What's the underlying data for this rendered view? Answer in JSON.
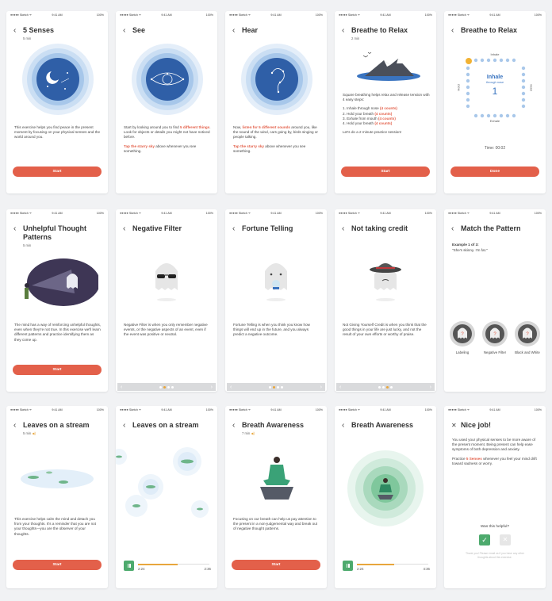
{
  "status": {
    "carrier": "●●●●● Sketch ᯤ",
    "time": "9:41 AM",
    "battery": "100%"
  },
  "colors": {
    "accent": "#e3604a",
    "green": "#4daa6d",
    "orange": "#e8a63c",
    "blue": "#3a74c0"
  },
  "s1": {
    "title": "5 Senses",
    "sub": "5 min",
    "body": "This exercise helps you find peace in the present moment by focusing on your physical senses and the world around you.",
    "btn": "Start"
  },
  "s2": {
    "title": "See",
    "b1": "Start by looking around you to find ",
    "b1h": "5 different things",
    "b1e": ". Look for objects or details you might not have noticed before.",
    "b2h": "Tap the starry sky",
    "b2e": " above whenever you see something."
  },
  "s3": {
    "title": "Hear",
    "b1": "Now, ",
    "b1h": "listen for 5 different sounds",
    "b1e": " around you, like the sound of the wind, cars going by, birds singing or people talking.",
    "b2h": "Tap the starry sky",
    "b2e": " above whenever you see something."
  },
  "s4": {
    "title": "Breathe to Relax",
    "sub": "2 min",
    "intro": "Square breathing helps relax and release tension with 4 easy steps:",
    "steps": [
      {
        "t": "1. Inhale through nose ",
        "h": "(4 counts)"
      },
      {
        "t": "2. Hold your breath ",
        "h": "(4 counts)"
      },
      {
        "t": "3. Exhale from mouth ",
        "h": "(4 counts)"
      },
      {
        "t": "4. Hold your breath ",
        "h": "(4 counts)"
      }
    ],
    "outro": "Let's do a 2 minute practice session!",
    "btn": "Start"
  },
  "s5": {
    "title": "Breathe to Relax",
    "top": "Inhale",
    "left": "Hold",
    "right": "Hold",
    "bottom": "Exhale",
    "phase": "Inhale",
    "through": "through nose",
    "count": "1",
    "timer": "Time: 00:02",
    "btn": "Done"
  },
  "s6": {
    "title": "Unhelpful Thought Patterns",
    "sub": "5 min",
    "body": "The mind has a way of reinforcing unhelpful thoughts, even when they're not true. In this exercise we'll learn different patterns and practice identifying them as they come up.",
    "btn": "Start"
  },
  "s7": {
    "title": "Negative Filter",
    "body": "Negative Filter is when you only remember negative events, or the negative aspects of an event, even if the event was positive or neutral."
  },
  "s8": {
    "title": "Fortune Telling",
    "body": "Fortune Telling is when you think you know how things will end up in the future, and you always predict a negative outcome."
  },
  "s9": {
    "title": "Not taking credit",
    "body": "Not Giving Yourself Credit is when you think that the good things in your life are just lucky, and not the result of your own efforts or worthy of praise."
  },
  "s10": {
    "title": "Match the Pattern",
    "example": "Example 1 of 3:",
    "quote": "\"She's skinny. I'm fat.\"",
    "options": [
      "Labeling",
      "Negative Filter",
      "Black and White"
    ]
  },
  "s11": {
    "title": "Leaves on a stream",
    "sub": "5 min",
    "body": "This exercise helps calm the mind and detach you from your thoughts. It's a reminder that you are not your thoughts—you are the observer of your thoughts.",
    "btn": "Start"
  },
  "s12": {
    "title": "Leaves on a stream",
    "t1": "2:24",
    "t2": "2:36",
    "progress": 0.55
  },
  "s13": {
    "title": "Breath Awareness",
    "sub": "7 min",
    "body": "Focusing on our breath can help us pay attention to the present in a non-judgemental way and break out of negative thought patterns.",
    "btn": "Start"
  },
  "s14": {
    "title": "Breath Awareness",
    "t1": "2:24",
    "t2": "4:36",
    "progress": 0.52
  },
  "s15": {
    "title": "Nice job!",
    "b1": "You used your physical senses to be more aware of the present moment. Being present can help ease symptoms of both depression and anxiety.",
    "b2": "Practice ",
    "b2h": "5 Senses",
    "b2e": " whenever you feel your mind drift toward sadness or worry.",
    "q": "Was this helpful?",
    "foot": "Thank you! Please email us if you have any other thoughts about this exercise."
  }
}
